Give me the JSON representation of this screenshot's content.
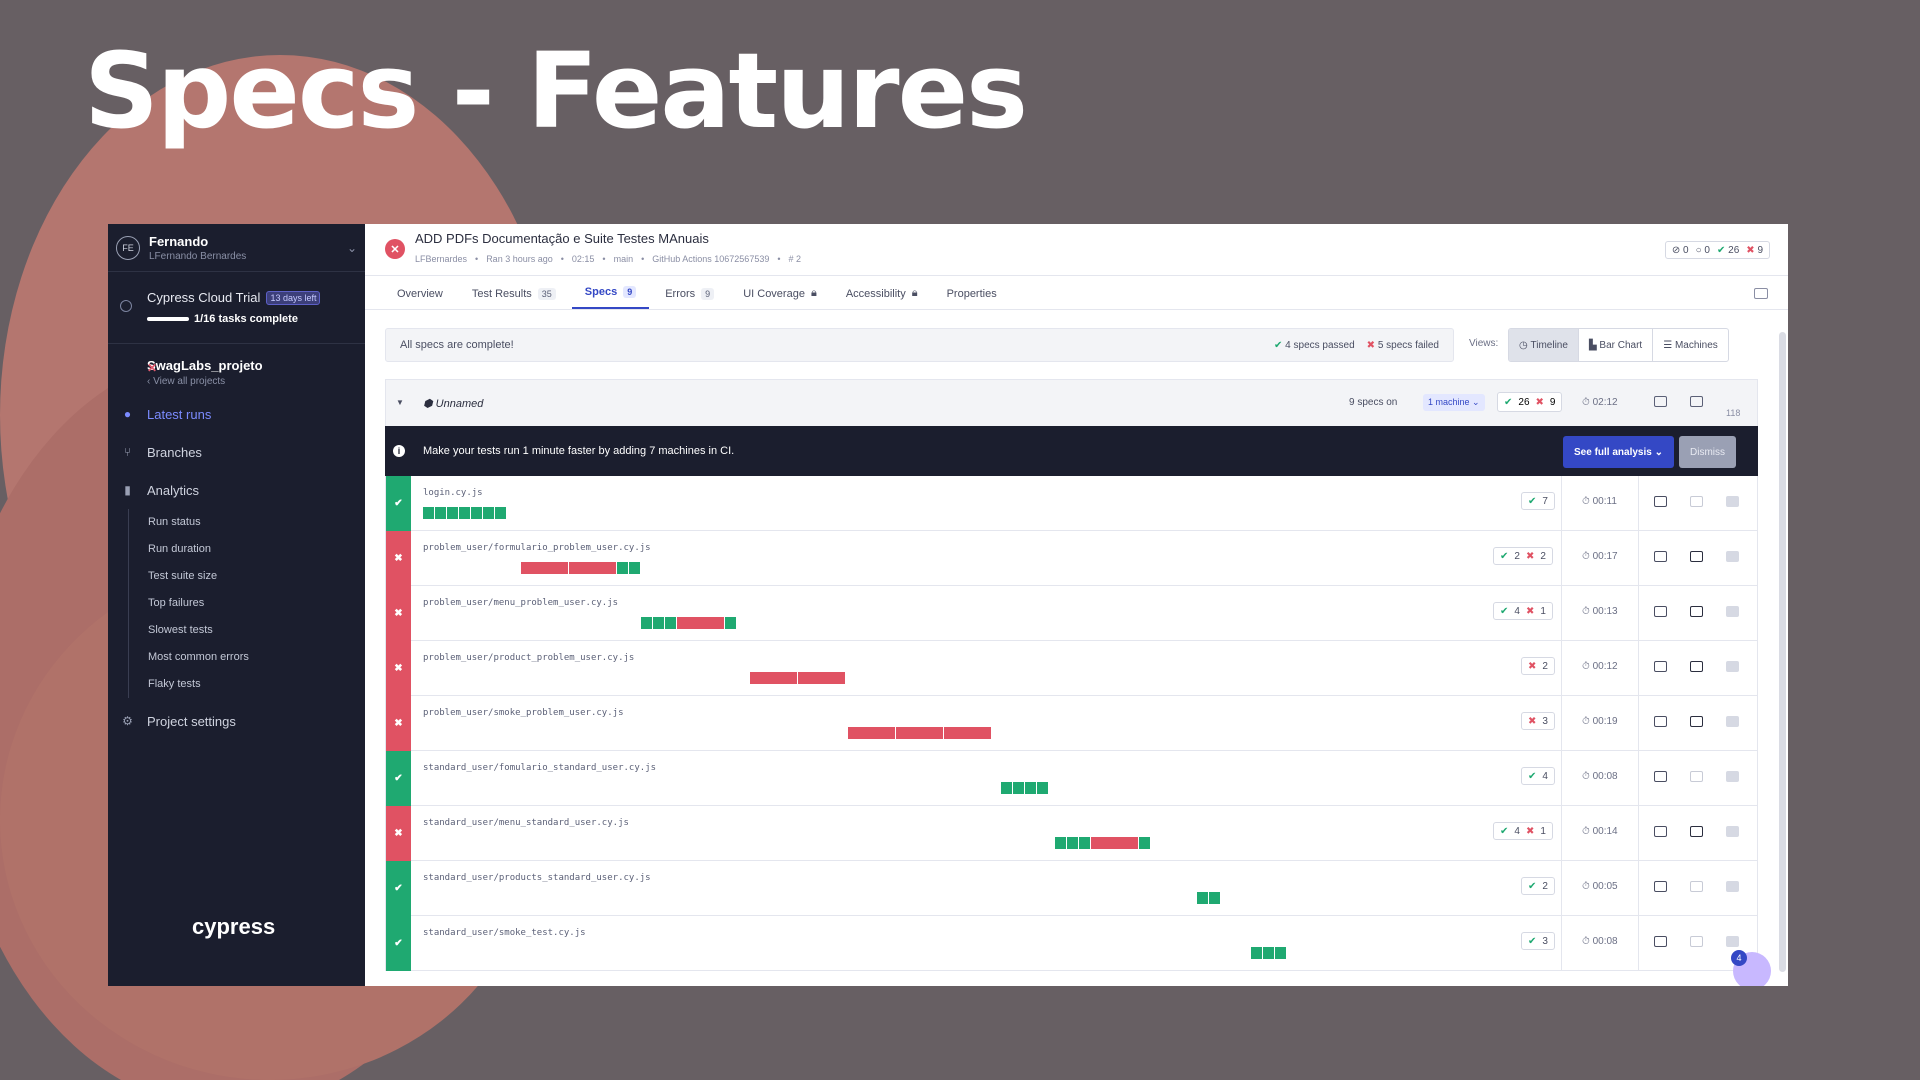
{
  "slide_title": "Specs - Features",
  "sidebar": {
    "user_initials": "FE",
    "user_name": "Fernando",
    "user_org": "LFernando Bernardes",
    "trial_title": "Cypress Cloud Trial",
    "trial_badge": "13 days left",
    "trial_progress": "1/16 tasks complete",
    "project_name": "SwagLabs_projeto",
    "view_all": "‹ View all projects",
    "nav": {
      "latest_runs": "Latest runs",
      "branches": "Branches",
      "analytics": "Analytics",
      "project_settings": "Project settings"
    },
    "analytics_items": [
      "Run status",
      "Run duration",
      "Test suite size",
      "Top failures",
      "Slowest tests",
      "Most common errors",
      "Flaky tests"
    ],
    "logo": "cypress"
  },
  "run": {
    "title": "ADD PDFs Documentação e Suite Testes MAnuais",
    "author": "LFBernardes",
    "ran": "Ran 3 hours ago",
    "duration": "02:15",
    "branch": "main",
    "ci": "GitHub Actions 10672567539",
    "number": "# 2",
    "counts": {
      "skipped": "0",
      "pending": "0",
      "passed": "26",
      "failed": "9"
    }
  },
  "tabs": [
    {
      "label": "Overview",
      "count": ""
    },
    {
      "label": "Test Results",
      "count": "35"
    },
    {
      "label": "Specs",
      "count": "9"
    },
    {
      "label": "Errors",
      "count": "9"
    },
    {
      "label": "UI Coverage",
      "count": ""
    },
    {
      "label": "Accessibility",
      "count": ""
    },
    {
      "label": "Properties",
      "count": ""
    }
  ],
  "banner": {
    "complete": "All specs are complete!",
    "passed": "4 specs passed",
    "failed": "5 specs failed",
    "views_label": "Views:",
    "views": [
      "Timeline",
      "Bar Chart",
      "Machines"
    ]
  },
  "group": {
    "name": "Unnamed",
    "specs_on": "9 specs on",
    "machine": "1 machine",
    "passed": "26",
    "failed": "9",
    "time": "02:12",
    "tests": "118"
  },
  "promo": {
    "message": "Make your tests run 1 minute faster by adding 7 machines in CI.",
    "see": "See full analysis",
    "dismiss": "Dismiss"
  },
  "specs": [
    {
      "path": "login.cy.js",
      "status": "pass",
      "passed": "7",
      "failed": "",
      "duration": "00:11",
      "start": 0.0,
      "segments": [
        "p",
        "p",
        "p",
        "p",
        "p",
        "p",
        "p"
      ],
      "screens": false
    },
    {
      "path": "problem_user/formulario_problem_user.cy.js",
      "status": "fail",
      "passed": "2",
      "failed": "2",
      "duration": "00:17",
      "start": 0.09,
      "segments": [
        "f",
        "f",
        "p",
        "p"
      ],
      "screens": true
    },
    {
      "path": "problem_user/menu_problem_user.cy.js",
      "status": "fail",
      "passed": "4",
      "failed": "1",
      "duration": "00:13",
      "start": 0.2,
      "segments": [
        "p",
        "p",
        "p",
        "f",
        "p"
      ],
      "screens": true
    },
    {
      "path": "problem_user/product_problem_user.cy.js",
      "status": "fail",
      "passed": "",
      "failed": "2",
      "duration": "00:12",
      "start": 0.3,
      "segments": [
        "f",
        "f"
      ],
      "screens": true
    },
    {
      "path": "problem_user/smoke_problem_user.cy.js",
      "status": "fail",
      "passed": "",
      "failed": "3",
      "duration": "00:19",
      "start": 0.39,
      "segments": [
        "f",
        "f",
        "f"
      ],
      "screens": true
    },
    {
      "path": "standard_user/fomulario_standard_user.cy.js",
      "status": "pass",
      "passed": "4",
      "failed": "",
      "duration": "00:08",
      "start": 0.53,
      "segments": [
        "p",
        "p",
        "p",
        "p"
      ],
      "screens": false
    },
    {
      "path": "standard_user/menu_standard_user.cy.js",
      "status": "fail",
      "passed": "4",
      "failed": "1",
      "duration": "00:14",
      "start": 0.58,
      "segments": [
        "p",
        "p",
        "p",
        "f",
        "p"
      ],
      "screens": true
    },
    {
      "path": "standard_user/products_standard_user.cy.js",
      "status": "pass",
      "passed": "2",
      "failed": "",
      "duration": "00:05",
      "start": 0.71,
      "segments": [
        "p",
        "p"
      ],
      "screens": false
    },
    {
      "path": "standard_user/smoke_test.cy.js",
      "status": "pass",
      "passed": "3",
      "failed": "",
      "duration": "00:08",
      "start": 0.76,
      "segments": [
        "p",
        "p",
        "p"
      ],
      "screens": false
    }
  ],
  "help_badge": "4",
  "colors": {
    "pass": "#1fa971",
    "fail": "#e05263",
    "accent": "#3448c5",
    "sidebar": "#1b1e2e"
  }
}
